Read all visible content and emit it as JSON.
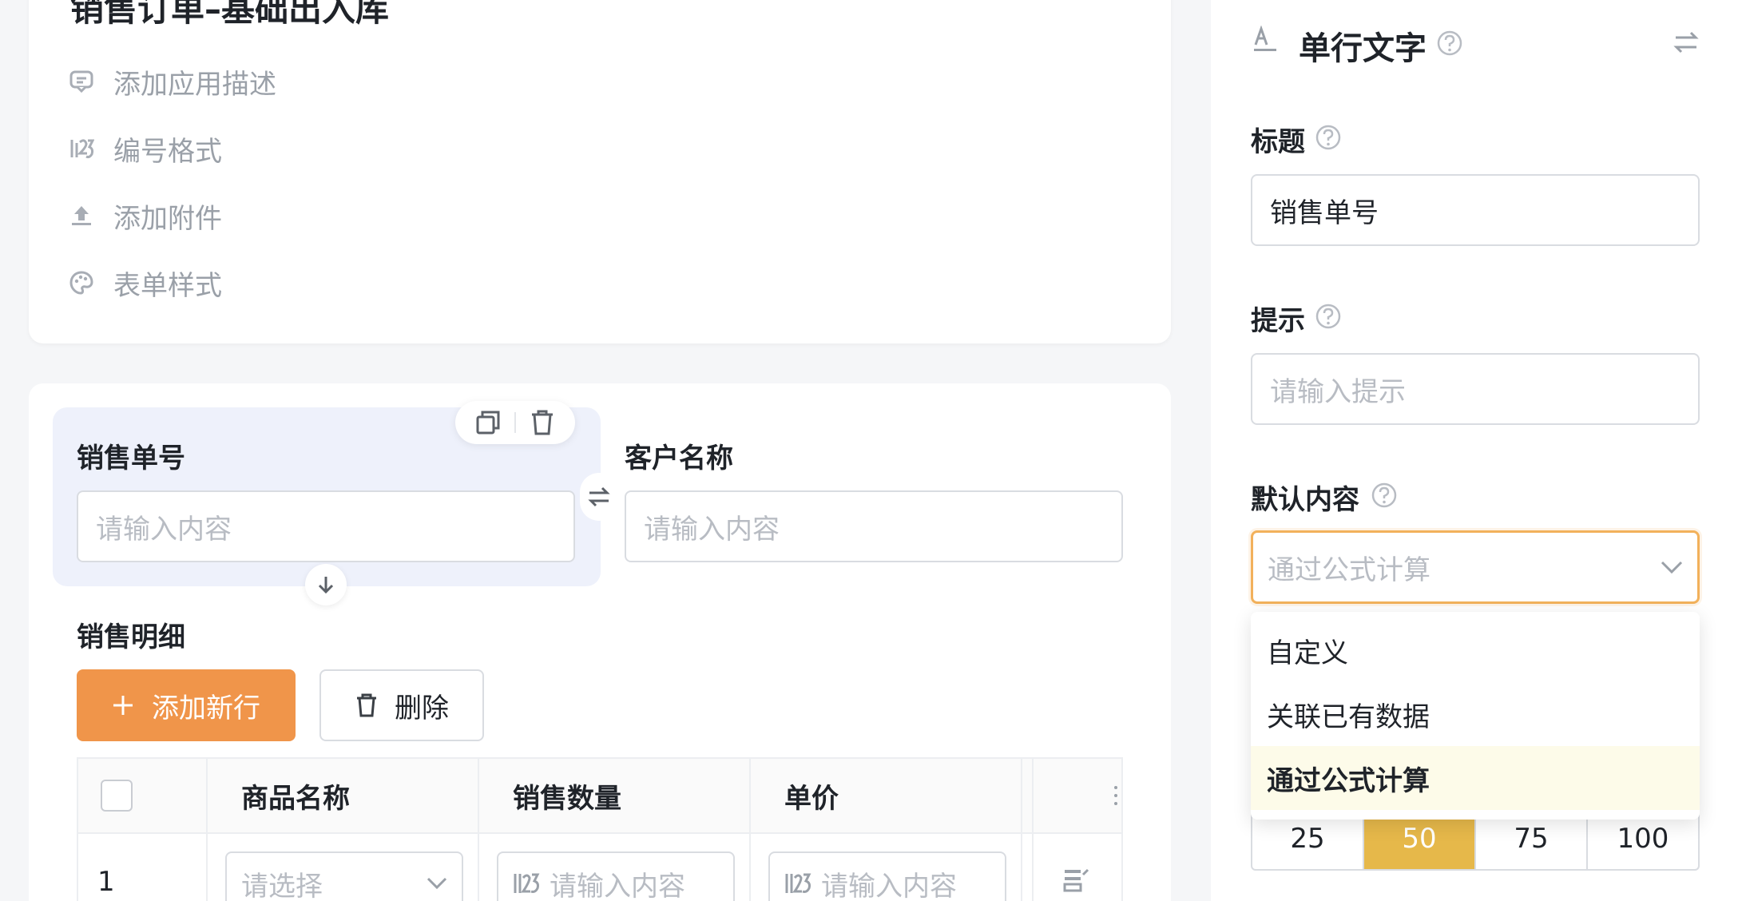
{
  "app": {
    "title": "销售订单–基础出入库",
    "meta_items": [
      {
        "label": "添加应用描述",
        "icon": "comment-icon"
      },
      {
        "label": "编号格式",
        "icon": "number-format-icon"
      },
      {
        "label": "添加附件",
        "icon": "upload-icon"
      },
      {
        "label": "表单样式",
        "icon": "palette-icon"
      }
    ]
  },
  "form": {
    "field1": {
      "label": "销售单号",
      "placeholder": "请输入内容"
    },
    "field2": {
      "label": "客户名称",
      "placeholder": "请输入内容"
    },
    "detail": {
      "label": "销售明细",
      "add_label": "添加新行",
      "delete_label": "删除",
      "columns": [
        "商品名称",
        "销售数量",
        "单价"
      ],
      "row": {
        "index": "1",
        "product_placeholder": "请选择",
        "qty_placeholder": "请输入内容",
        "price_placeholder": "请输入内容"
      }
    }
  },
  "panel": {
    "field_type": "单行文字",
    "title_label": "标题",
    "title_value": "销售单号",
    "hint_label": "提示",
    "hint_placeholder": "请输入提示",
    "default_label": "默认内容",
    "default_selected": "通过公式计算",
    "default_options": [
      "自定义",
      "关联已有数据",
      "通过公式计算"
    ],
    "width_options": [
      "25",
      "50",
      "75",
      "100"
    ],
    "width_selected": "50"
  },
  "colors": {
    "accent": "#f0954a",
    "focus_border": "#f2b15b",
    "segment_active": "#e6b84a",
    "selected_field_bg": "#eef1fb"
  }
}
